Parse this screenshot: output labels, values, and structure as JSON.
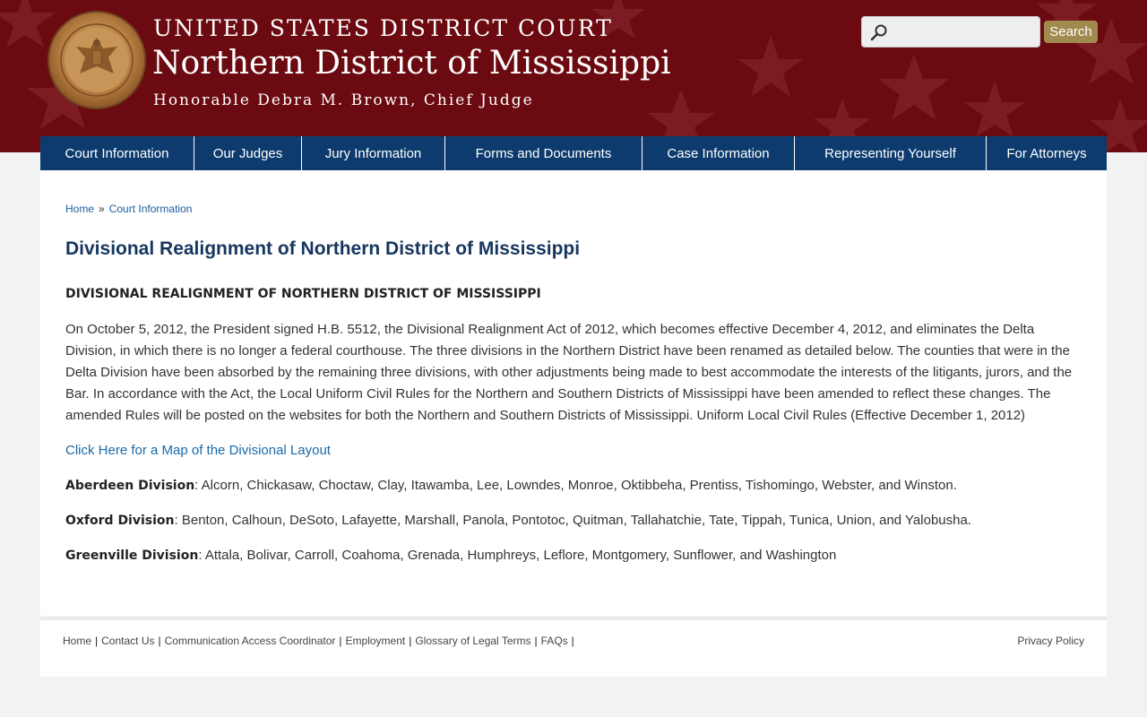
{
  "colors": {
    "header_bg": "#6b0a10",
    "nav_bg": "#0d3b6e",
    "search_button_bg": "#a08a4e",
    "link": "#1a6aa8",
    "title": "#16365e"
  },
  "header": {
    "court_name": "UNITED STATES DISTRICT COURT",
    "district": "Northern District of Mississippi",
    "chief_judge": "Honorable Debra M. Brown, Chief Judge",
    "seal_icon": "court-seal-icon"
  },
  "search": {
    "placeholder": "",
    "value": "",
    "button_label": "Search",
    "icon": "search-icon"
  },
  "nav": {
    "items": [
      {
        "label": "Court Information"
      },
      {
        "label": "Our Judges"
      },
      {
        "label": "Jury Information"
      },
      {
        "label": "Forms and Documents"
      },
      {
        "label": "Case Information"
      },
      {
        "label": "Representing Yourself"
      },
      {
        "label": "For Attorneys"
      }
    ]
  },
  "breadcrumb": {
    "home": "Home",
    "separator": "»",
    "current": "Court Information"
  },
  "main": {
    "page_title": "Divisional Realignment of Northern District of Mississippi",
    "section_heading": "DIVISIONAL REALIGNMENT OF NORTHERN DISTRICT OF MISSISSIPPI",
    "paragraph": "On October 5, 2012, the President signed H.B. 5512, the Divisional Realignment Act of 2012, which becomes effective December 4, 2012, and eliminates the Delta Division, in which there is no longer a federal courthouse. The three divisions in the Northern District have been renamed as detailed below. The counties that were in the Delta Division have been absorbed by the remaining three divisions, with other adjustments being made to best accommodate the interests of the litigants, jurors, and the Bar. In accordance with the Act, the Local Uniform Civil Rules for the Northern and Southern Districts of Mississippi have been amended to reflect these changes. The amended Rules will be posted on the websites for both the Northern and Southern Districts of Mississippi. Uniform Local Civil Rules (Effective December 1, 2012)",
    "map_link": "Click Here for a Map of the Divisional Layout",
    "divisions": [
      {
        "name": "Aberdeen Division",
        "counties": ": Alcorn, Chickasaw, Choctaw, Clay, Itawamba, Lee, Lowndes, Monroe, Oktibbeha, Prentiss, Tishomingo, Webster, and Winston."
      },
      {
        "name": "Oxford Division",
        "counties": ": Benton, Calhoun, DeSoto, Lafayette, Marshall, Panola, Pontotoc, Quitman, Tallahatchie, Tate, Tippah, Tunica, Union, and Yalobusha."
      },
      {
        "name": "Greenville Division",
        "counties": ": Attala, Bolivar, Carroll, Coahoma, Grenada, Humphreys, Leflore, Montgomery, Sunflower, and Washington"
      }
    ]
  },
  "footer": {
    "links": [
      {
        "label": "Home"
      },
      {
        "label": "Contact Us"
      },
      {
        "label": "Communication Access Coordinator"
      },
      {
        "label": "Employment"
      },
      {
        "label": "Glossary of Legal Terms"
      },
      {
        "label": "FAQs"
      }
    ],
    "separator": "|",
    "privacy": "Privacy Policy"
  }
}
